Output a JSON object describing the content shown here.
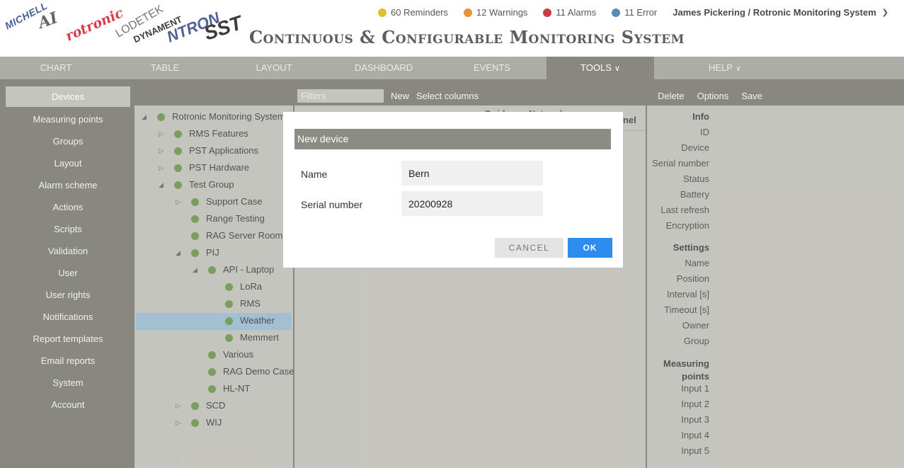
{
  "header": {
    "logos": [
      "MICHELL",
      "AI",
      "rotronic",
      "LODETEK",
      "DYNAMENT",
      "NTRON",
      "SST"
    ],
    "status": [
      {
        "label": "60 Reminders",
        "color": "#d4b400"
      },
      {
        "label": "12 Warnings",
        "color": "#e07a10"
      },
      {
        "label": "11 Alarms",
        "color": "#c0101c"
      },
      {
        "label": "11 Error",
        "color": "#3d6ea8"
      }
    ],
    "user": "James Pickering / Rotronic Monitoring System",
    "app_title": "Continuous & Configurable Monitoring System"
  },
  "nav": {
    "items": [
      {
        "label": "CHART",
        "chevron": false
      },
      {
        "label": "TABLE",
        "chevron": false
      },
      {
        "label": "LAYOUT",
        "chevron": false
      },
      {
        "label": "DASHBOARD",
        "chevron": false
      },
      {
        "label": "EVENTS",
        "chevron": false
      },
      {
        "label": "TOOLS",
        "chevron": true
      },
      {
        "label": "HELP",
        "chevron": true
      }
    ]
  },
  "sidebar": {
    "items": [
      {
        "label": "Devices",
        "active": true
      },
      {
        "label": "Measuring points"
      },
      {
        "label": "Groups"
      },
      {
        "label": "Layout"
      },
      {
        "label": "Alarm scheme"
      },
      {
        "label": "Actions"
      },
      {
        "label": "Scripts"
      },
      {
        "label": "Validation"
      },
      {
        "label": "User"
      },
      {
        "label": "User rights"
      },
      {
        "label": "Notifications"
      },
      {
        "label": "Report templates"
      },
      {
        "label": "Email reports"
      },
      {
        "label": "System"
      },
      {
        "label": "Account"
      }
    ]
  },
  "tree": {
    "nodes": [
      {
        "label": "Rotronic Monitoring System",
        "level": 0,
        "arrow": "expanded"
      },
      {
        "label": "RMS Features",
        "level": 1,
        "arrow": "collapsed"
      },
      {
        "label": "PST Applications",
        "level": 1,
        "arrow": "collapsed"
      },
      {
        "label": "PST Hardware",
        "level": 1,
        "arrow": "collapsed"
      },
      {
        "label": "Test Group",
        "level": 1,
        "arrow": "expanded"
      },
      {
        "label": "Support Case",
        "level": 2,
        "arrow": "collapsed"
      },
      {
        "label": "Range Testing",
        "level": 2,
        "arrow": "none"
      },
      {
        "label": "RAG Server Room",
        "level": 2,
        "arrow": "none"
      },
      {
        "label": "PIJ",
        "level": 2,
        "arrow": "expanded"
      },
      {
        "label": "API - Laptop",
        "level": 3,
        "arrow": "expanded"
      },
      {
        "label": "LoRa",
        "level": 4,
        "arrow": "none"
      },
      {
        "label": "RMS",
        "level": 4,
        "arrow": "none"
      },
      {
        "label": "Weather",
        "level": 4,
        "arrow": "none",
        "selected": true
      },
      {
        "label": "Memmert",
        "level": 4,
        "arrow": "none"
      },
      {
        "label": "Various",
        "level": 3,
        "arrow": "none"
      },
      {
        "label": "RAG Demo Case",
        "level": 3,
        "arrow": "none"
      },
      {
        "label": "HL-NT",
        "level": 3,
        "arrow": "none"
      },
      {
        "label": "SCD",
        "level": 2,
        "arrow": "collapsed"
      },
      {
        "label": "WIJ",
        "level": 2,
        "arrow": "collapsed"
      }
    ]
  },
  "middle": {
    "filter_placeholder": "Filters",
    "new_label": "New",
    "select_columns_label": "Select columns",
    "partial_header_1": "Guidance Network",
    "partial_header_2": "nnel"
  },
  "right": {
    "toolbar": {
      "delete": "Delete",
      "options": "Options",
      "save": "Save"
    },
    "props": [
      {
        "label": "Info",
        "section": true
      },
      {
        "label": "ID"
      },
      {
        "label": "Device"
      },
      {
        "label": "Serial number"
      },
      {
        "label": "Status"
      },
      {
        "label": "Battery"
      },
      {
        "label": "Last refresh"
      },
      {
        "label": "Encryption"
      },
      {
        "label": "Settings",
        "section": true
      },
      {
        "label": "Name"
      },
      {
        "label": "Position"
      },
      {
        "label": "Interval [s]"
      },
      {
        "label": "Timeout [s]"
      },
      {
        "label": "Owner"
      },
      {
        "label": "Group"
      },
      {
        "label": "Measuring points",
        "section": true
      },
      {
        "label": "Input 1"
      },
      {
        "label": "Input 2"
      },
      {
        "label": "Input 3"
      },
      {
        "label": "Input 4"
      },
      {
        "label": "Input 5"
      }
    ]
  },
  "modal": {
    "title": "New device",
    "name_label": "Name",
    "name_value": "Bern",
    "serial_label": "Serial number",
    "serial_value": "20200928",
    "cancel_label": "CANCEL",
    "ok_label": "OK"
  }
}
